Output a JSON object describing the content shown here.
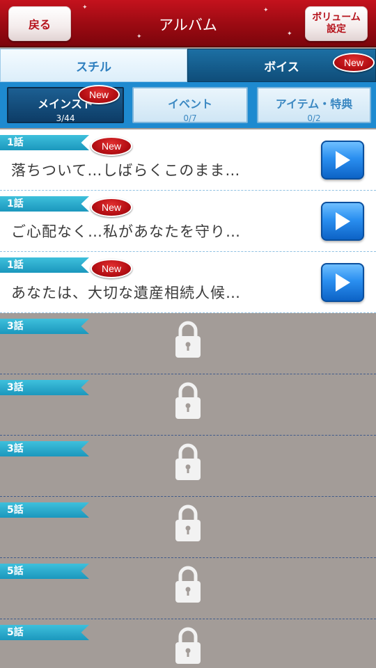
{
  "header": {
    "back_label": "戻る",
    "title": "アルバム",
    "volume_label": "ボリューム\n設定"
  },
  "main_tabs": [
    {
      "label": "スチル",
      "selected": false,
      "new": false
    },
    {
      "label": "ボイス",
      "selected": true,
      "new": true
    }
  ],
  "sub_tabs": [
    {
      "label": "メインスト",
      "count": "3/44",
      "selected": true,
      "new": true
    },
    {
      "label": "イベント",
      "count": "0/7",
      "selected": false,
      "new": false
    },
    {
      "label": "アイテム・特典",
      "count": "0/2",
      "selected": false,
      "new": false
    }
  ],
  "badge_text": "New",
  "list": [
    {
      "episode": "1話",
      "text": "落ちついて…しばらくこのまま…",
      "locked": false,
      "new": true
    },
    {
      "episode": "1話",
      "text": "ご心配なく…私があなたを守り…",
      "locked": false,
      "new": true
    },
    {
      "episode": "1話",
      "text": "あなたは、大切な遺産相続人候…",
      "locked": false,
      "new": true
    },
    {
      "episode": "3話",
      "text": "",
      "locked": true,
      "new": false
    },
    {
      "episode": "3話",
      "text": "",
      "locked": true,
      "new": false
    },
    {
      "episode": "3話",
      "text": "",
      "locked": true,
      "new": false
    },
    {
      "episode": "5話",
      "text": "",
      "locked": true,
      "new": false
    },
    {
      "episode": "5話",
      "text": "",
      "locked": true,
      "new": false
    },
    {
      "episode": "5話",
      "text": "",
      "locked": true,
      "new": false
    }
  ],
  "colors": {
    "header_red": "#b5121b",
    "ribbon_blue": "#1b97bd",
    "play_blue": "#2a8ff0",
    "locked_bg": "#a39c98"
  },
  "icons": [
    "play-icon",
    "lock-icon"
  ]
}
